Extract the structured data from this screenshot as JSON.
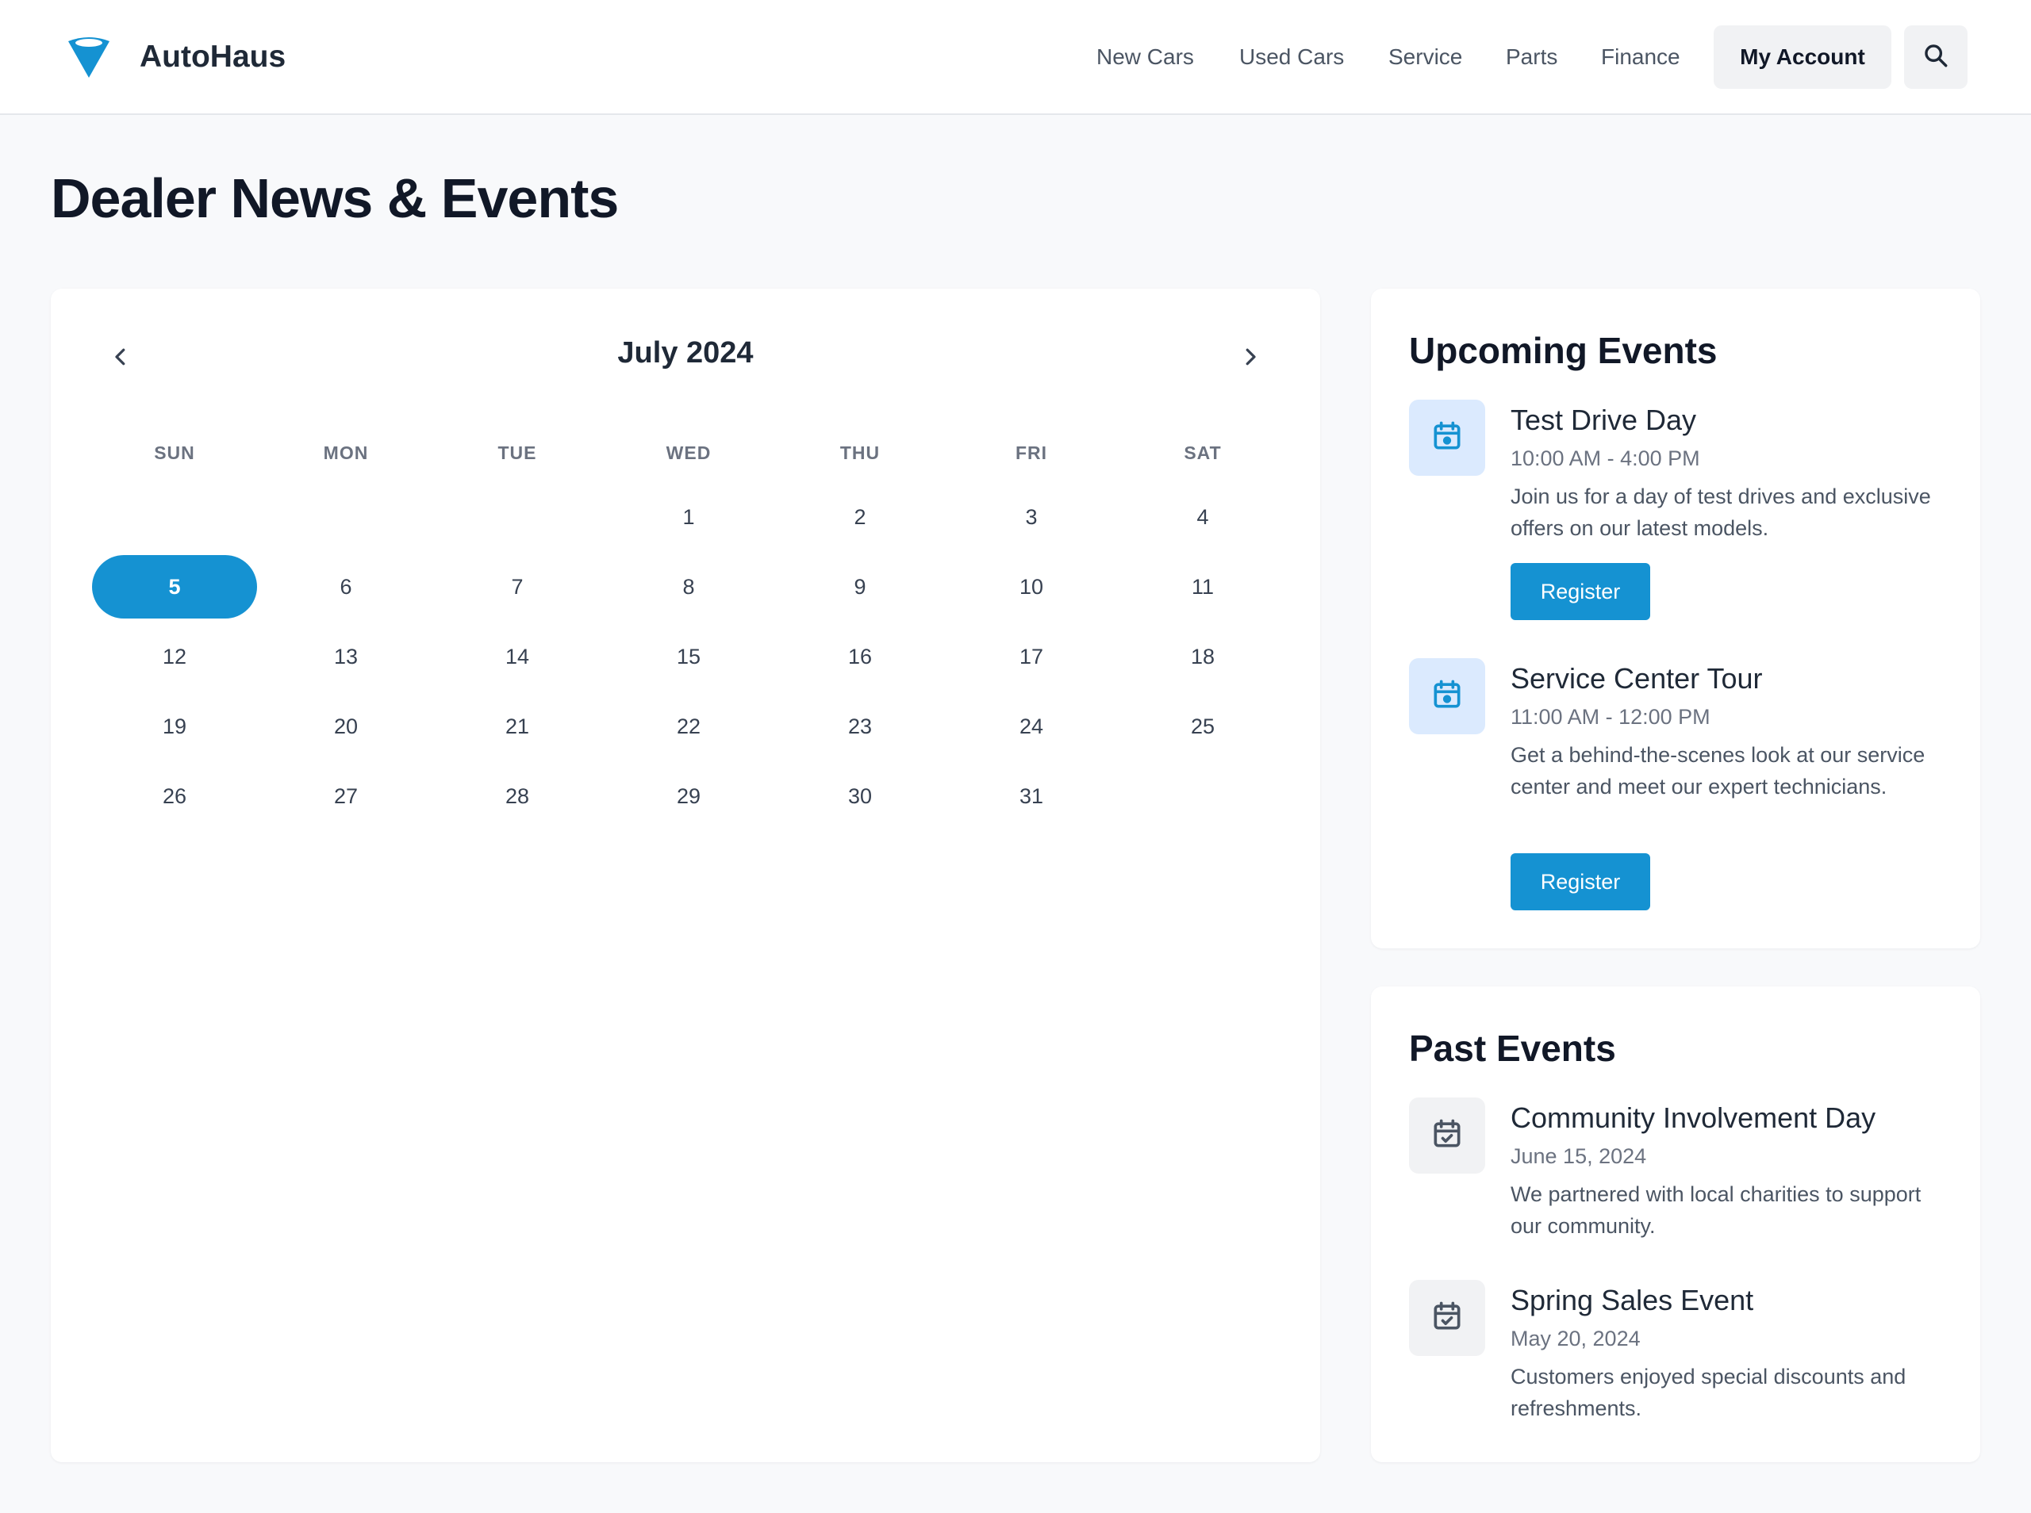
{
  "header": {
    "brand": "AutoHaus",
    "nav": [
      "New Cars",
      "Used Cars",
      "Service",
      "Parts",
      "Finance"
    ],
    "account_label": "My Account"
  },
  "page": {
    "title": "Dealer News & Events"
  },
  "calendar": {
    "month_label": "July 2024",
    "weekdays": [
      "SUN",
      "MON",
      "TUE",
      "WED",
      "THU",
      "FRI",
      "SAT"
    ],
    "first_weekday_index": 3,
    "days_in_month": 31,
    "selected_day": 5
  },
  "upcoming": {
    "title": "Upcoming Events",
    "events": [
      {
        "title": "Test Drive Day",
        "time": "10:00 AM - 4:00 PM",
        "description": "Join us for a day of test drives and exclusive offers on our latest models.",
        "button": "Register"
      },
      {
        "title": "Service Center Tour",
        "time": "11:00 AM - 12:00 PM",
        "description": "Get a behind-the-scenes look at our service center and meet our expert technicians.",
        "button": "Register"
      }
    ]
  },
  "past": {
    "title": "Past Events",
    "events": [
      {
        "title": "Community Involvement Day",
        "date": "June 15, 2024",
        "description": "We partnered with local charities to support our community."
      },
      {
        "title": "Spring Sales Event",
        "date": "May 20, 2024",
        "description": "Customers enjoyed special discounts and refreshments."
      }
    ]
  },
  "colors": {
    "accent": "#1592d2",
    "icon_bg_upcoming": "#dbeafe",
    "icon_bg_past": "#f1f2f4"
  }
}
